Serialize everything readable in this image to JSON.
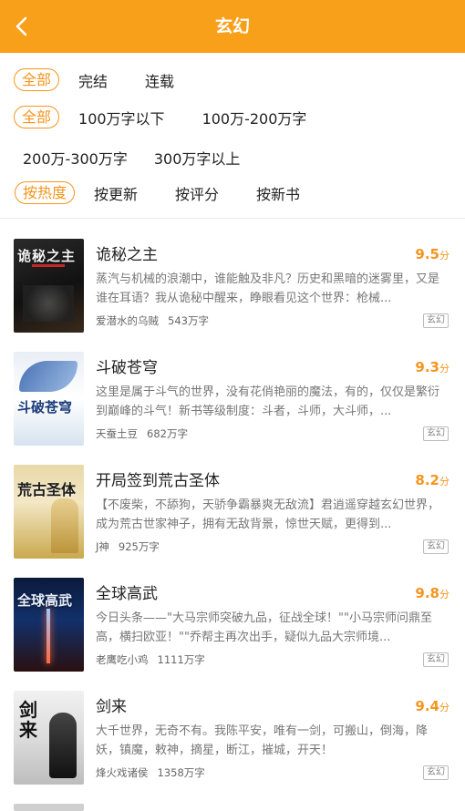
{
  "header": {
    "title": "玄幻",
    "back_icon": "chevron-left-icon"
  },
  "filters": {
    "status": [
      "全部",
      "完结",
      "连载"
    ],
    "length_row1": [
      "全部",
      "100万字以下",
      "100万-200万字"
    ],
    "length_row2": [
      "200万-300万字",
      "300万字以上"
    ],
    "sort": [
      "按热度",
      "按更新",
      "按评分",
      "按新书"
    ]
  },
  "colors": {
    "accent": "#f7941d",
    "header_bg": "#f9a01b"
  },
  "books": [
    {
      "title": "诡秘之主",
      "score": "9.5",
      "score_unit": "分",
      "desc": "蒸汽与机械的浪潮中，谁能触及非凡？历史和黑暗的迷雾里，又是谁在耳语？我从诡秘中醒来，睁眼看见这个世界：枪械...",
      "author": "爱潜水的乌贼",
      "words": "543万字",
      "tag": "玄幻",
      "cover_text": "诡秘之主"
    },
    {
      "title": "斗破苍穹",
      "score": "9.3",
      "score_unit": "分",
      "desc": "这里是属于斗气的世界，没有花俏艳丽的魔法，有的，仅仅是繁衍到巅峰的斗气！新书等级制度：斗者，斗师，大斗师，...",
      "author": "天蚕土豆",
      "words": "682万字",
      "tag": "玄幻",
      "cover_text": "斗破苍穹"
    },
    {
      "title": "开局签到荒古圣体",
      "score": "8.2",
      "score_unit": "分",
      "desc": "【不废柴，不舔狗，天骄争霸暴爽无敌流】君逍遥穿越玄幻世界，成为荒古世家神子，拥有无敌背景，惊世天赋，更得到...",
      "author": "J神",
      "words": "925万字",
      "tag": "玄幻",
      "cover_text": "荒古圣体"
    },
    {
      "title": "全球高武",
      "score": "9.8",
      "score_unit": "分",
      "desc": "今日头条——\"大马宗师突破九品，征战全球！\"\"小马宗师问鼎至高，横扫欧亚！\"\"乔帮主再次出手，疑似九品大宗师境...",
      "author": "老鹰吃小鸡",
      "words": "1111万字",
      "tag": "玄幻",
      "cover_text": "全球高武"
    },
    {
      "title": "剑来",
      "score": "9.4",
      "score_unit": "分",
      "desc": "大千世界，无奇不有。我陈平安，唯有一剑，可搬山，倒海，降妖，镇魔，敕神，摘星，断江，摧城，开天！",
      "author": "烽火戏诸侯",
      "words": "1358万字",
      "tag": "玄幻",
      "cover_text": "剑来"
    }
  ]
}
